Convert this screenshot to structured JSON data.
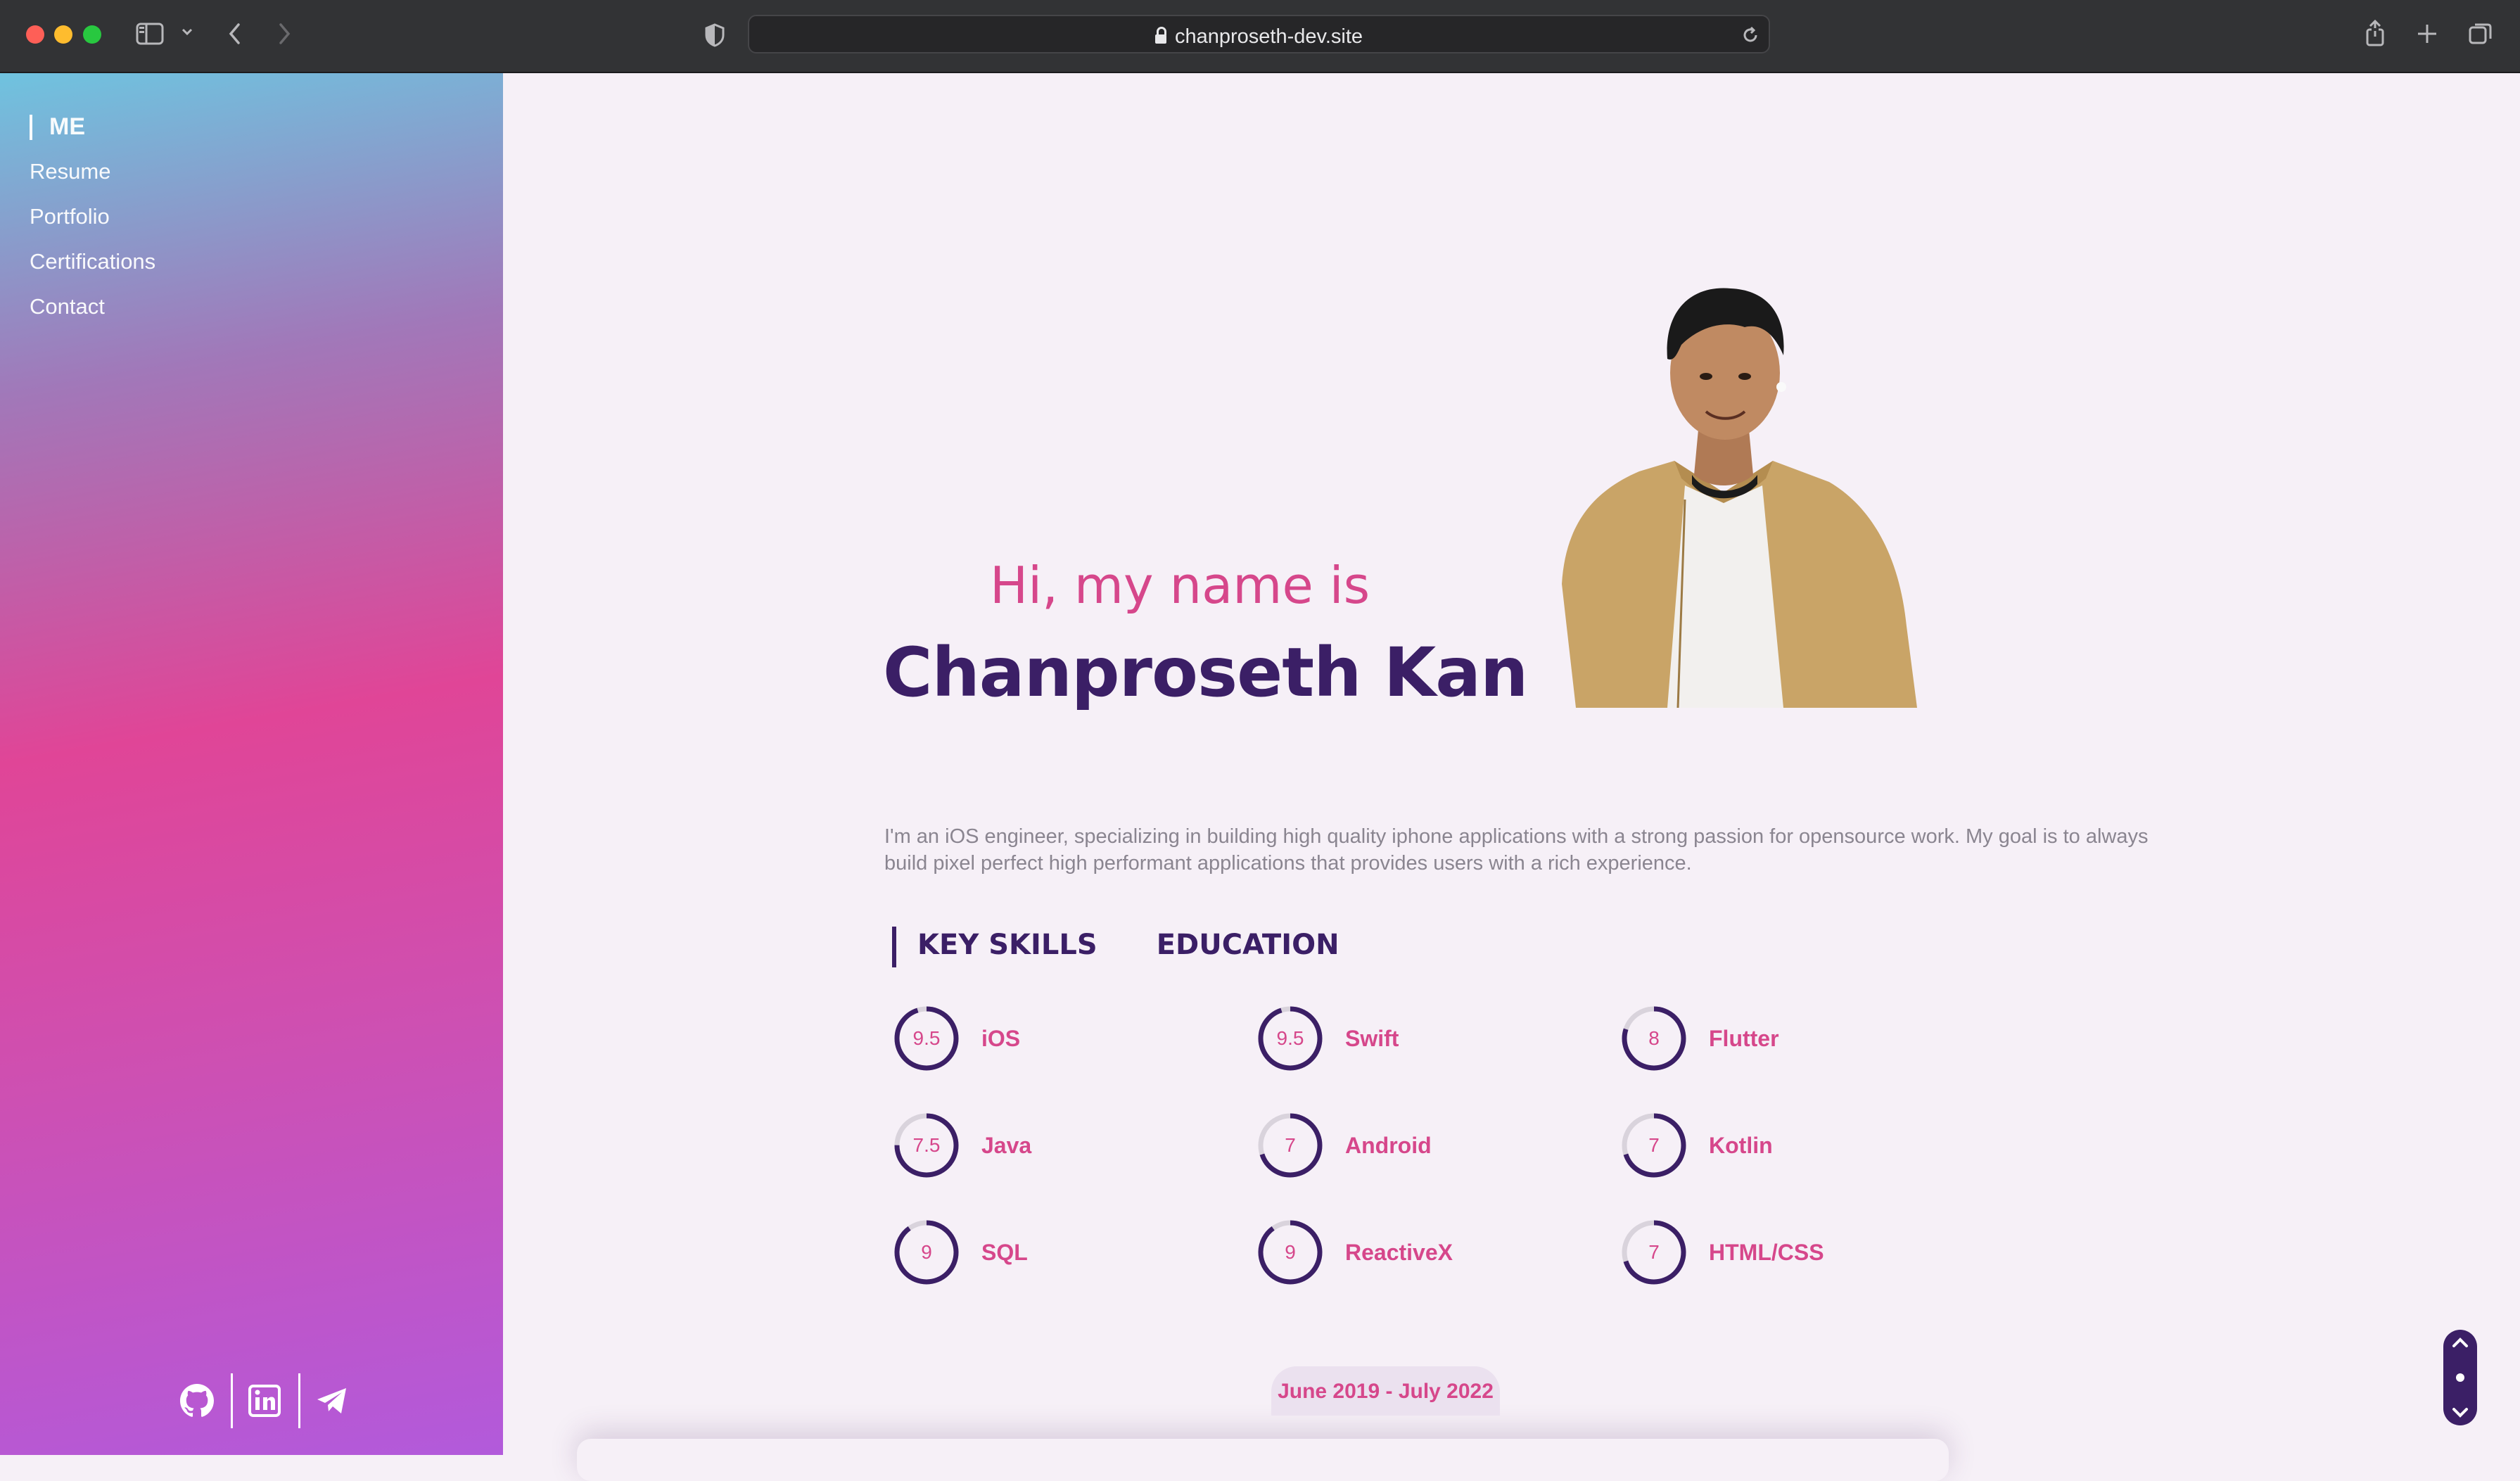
{
  "browser": {
    "url": "chanproseth-dev.site"
  },
  "sidebar": {
    "items": [
      {
        "label": "ME",
        "active": true
      },
      {
        "label": "Resume"
      },
      {
        "label": "Portfolio"
      },
      {
        "label": "Certifications"
      },
      {
        "label": "Contact"
      }
    ],
    "socials": [
      "github-icon",
      "linkedin-icon",
      "telegram-icon"
    ]
  },
  "hero": {
    "greeting": "Hi, my name is",
    "name": "Chanproseth Kan",
    "bio": "I'm an iOS engineer, specializing in building high quality iphone applications with a strong passion for opensource work. My goal is to always build pixel perfect high performant applications that provides users with a rich experience."
  },
  "tabs": [
    {
      "label": "KEY SKILLS",
      "active": true
    },
    {
      "label": "EDUCATION"
    }
  ],
  "skills": [
    {
      "score": "9.5",
      "name": "iOS",
      "value": 9.5
    },
    {
      "score": "9.5",
      "name": "Swift",
      "value": 9.5
    },
    {
      "score": "8",
      "name": "Flutter",
      "value": 8
    },
    {
      "score": "7.5",
      "name": "Java",
      "value": 7.5
    },
    {
      "score": "7",
      "name": "Android",
      "value": 7
    },
    {
      "score": "7",
      "name": "Kotlin",
      "value": 7
    },
    {
      "score": "9",
      "name": "SQL",
      "value": 9
    },
    {
      "score": "9",
      "name": "ReactiveX",
      "value": 9
    },
    {
      "score": "7",
      "name": "HTML/CSS",
      "value": 7
    }
  ],
  "education": {
    "date_range": "June 2019 - July 2022"
  },
  "colors": {
    "accent_pink": "#d6478b",
    "accent_purple": "#3b1f66",
    "ring_track": "#d9d3dc"
  }
}
